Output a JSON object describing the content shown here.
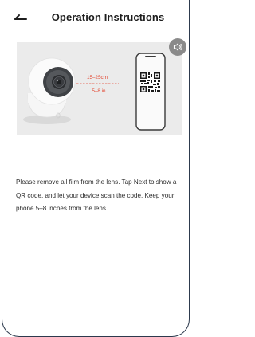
{
  "header": {
    "title": "Operation Instructions"
  },
  "illustration": {
    "distance_cm": "15–25cm",
    "distance_in": "5–8 in"
  },
  "instructions": {
    "text": "Please remove all film from the lens. Tap Next to show a QR code, and let your device scan the code. Keep your phone 5–8 inches from the lens."
  },
  "colors": {
    "accent_red": "#e3452f",
    "hero_background": "#ebebeb",
    "sound_button": "#8a8a8a"
  },
  "icons": {
    "back": "back-arrow-icon",
    "sound": "speaker-icon"
  }
}
